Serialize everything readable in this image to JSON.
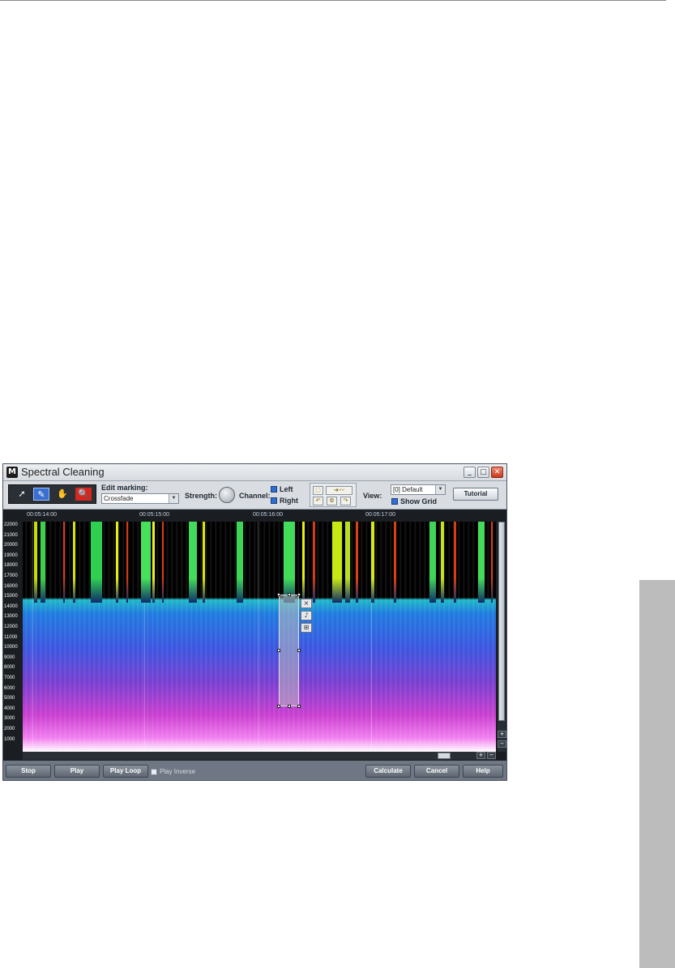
{
  "window": {
    "title": "Spectral Cleaning",
    "logo_letter": "M",
    "controls": {
      "minimize": "_",
      "maximize": "□",
      "close": "✕"
    }
  },
  "toolbar": {
    "tools": [
      {
        "name": "pointer",
        "glyph": "➚"
      },
      {
        "name": "pencil",
        "glyph": "✎"
      },
      {
        "name": "hand",
        "glyph": "✋"
      },
      {
        "name": "zoom",
        "glyph": "🔍"
      }
    ],
    "edit_marking_label": "Edit marking:",
    "edit_marking_value": "Crossfade",
    "strength_label": "Strength:",
    "channel_label": "Channel:",
    "channel_left": "Left",
    "channel_right": "Right",
    "view_label": "View:",
    "view_value": "[0] Default",
    "show_grid_label": "Show Grid",
    "tutorial_label": "Tutorial"
  },
  "spectrogram": {
    "time_labels": [
      "00:05:14:00",
      "00:05:15:00",
      "00:05:16:00",
      "00:05:17:00"
    ],
    "freq_labels": [
      "22000",
      "21000",
      "20000",
      "19000",
      "18000",
      "17000",
      "16000",
      "15000",
      "14000",
      "13000",
      "12000",
      "11000",
      "10000",
      "9000",
      "8000",
      "7000",
      "6000",
      "5000",
      "4000",
      "3000",
      "2000",
      "1000"
    ],
    "selection_buttons": [
      "×",
      "♪",
      "⊞"
    ],
    "zoom_plus": "+",
    "zoom_minus": "−"
  },
  "bottom": {
    "stop": "Stop",
    "play": "Play",
    "play_loop": "Play Loop",
    "play_inverse": "Play Inverse",
    "calculate": "Calculate",
    "cancel": "Cancel",
    "help": "Help"
  }
}
